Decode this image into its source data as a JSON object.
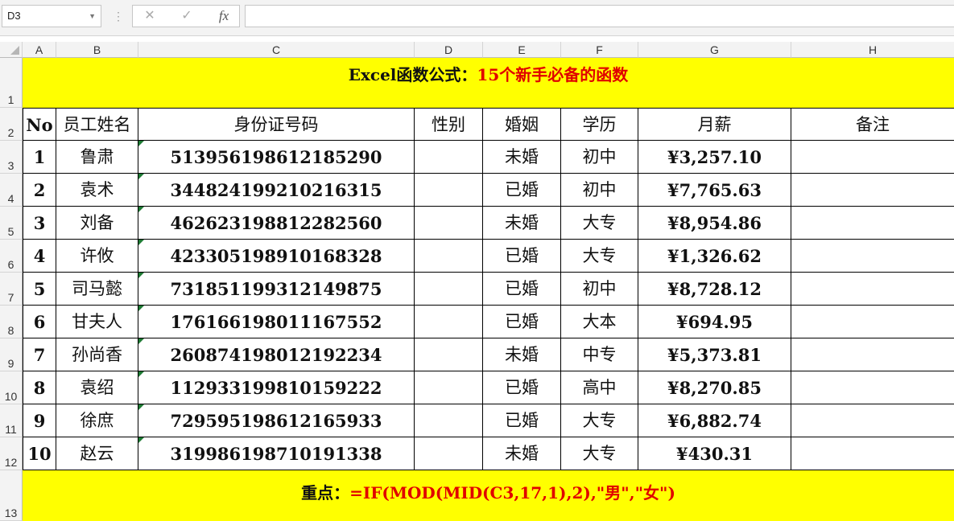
{
  "formula_bar": {
    "name_box": "D3",
    "cancel_icon": "✕",
    "enter_icon": "✓",
    "fx_label": "fx",
    "formula_value": ""
  },
  "columns": [
    "A",
    "B",
    "C",
    "D",
    "E",
    "F",
    "G",
    "H"
  ],
  "rows": [
    "1",
    "2",
    "3",
    "4",
    "5",
    "6",
    "7",
    "8",
    "9",
    "10",
    "11",
    "12",
    "13"
  ],
  "title": {
    "black": "Excel函数公式：",
    "red": "15个新手必备的函数"
  },
  "table": {
    "headers": [
      "No",
      "员工姓名",
      "身份证号码",
      "性别",
      "婚姻",
      "学历",
      "月薪",
      "备注"
    ],
    "rows": [
      [
        "1",
        "鲁肃",
        "513956198612185290",
        "",
        "未婚",
        "初中",
        "¥3,257.10",
        ""
      ],
      [
        "2",
        "袁术",
        "344824199210216315",
        "",
        "已婚",
        "初中",
        "¥7,765.63",
        ""
      ],
      [
        "3",
        "刘备",
        "462623198812282560",
        "",
        "未婚",
        "大专",
        "¥8,954.86",
        ""
      ],
      [
        "4",
        "许攸",
        "423305198910168328",
        "",
        "已婚",
        "大专",
        "¥1,326.62",
        ""
      ],
      [
        "5",
        "司马懿",
        "731851199312149875",
        "",
        "已婚",
        "初中",
        "¥8,728.12",
        ""
      ],
      [
        "6",
        "甘夫人",
        "176166198011167552",
        "",
        "已婚",
        "大本",
        "¥694.95",
        ""
      ],
      [
        "7",
        "孙尚香",
        "260874198012192234",
        "",
        "未婚",
        "中专",
        "¥5,373.81",
        ""
      ],
      [
        "8",
        "袁绍",
        "112933199810159222",
        "",
        "已婚",
        "高中",
        "¥8,270.85",
        ""
      ],
      [
        "9",
        "徐庶",
        "729595198612165933",
        "",
        "已婚",
        "大专",
        "¥6,882.74",
        ""
      ],
      [
        "10",
        "赵云",
        "319986198710191338",
        "",
        "未婚",
        "大专",
        "¥430.31",
        ""
      ]
    ]
  },
  "footer": {
    "black": "重点：",
    "red": "=IF(MOD(MID(C3,17,1),2),\"男\",\"女\")"
  }
}
